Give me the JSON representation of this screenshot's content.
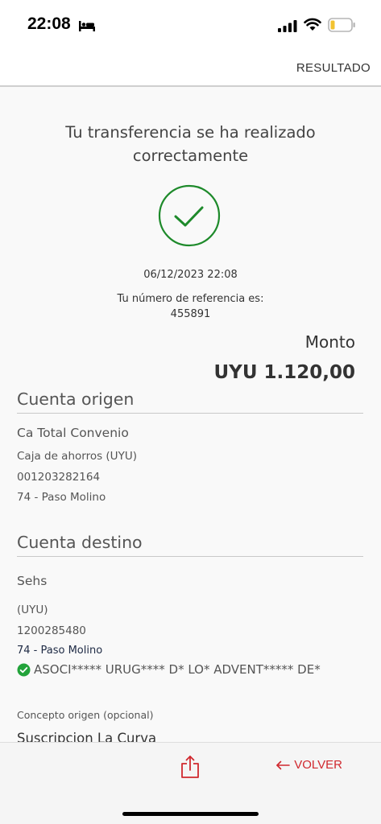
{
  "status_bar": {
    "time": "22:08"
  },
  "header": {
    "title": "RESULTADO"
  },
  "result": {
    "message": "Tu transferencia se ha realizado correctamente",
    "datetime": "06/12/2023 22:08",
    "reference_label": "Tu número de referencia es:",
    "reference_number": "455891",
    "amount_label": "Monto",
    "amount_value": "UYU 1.120,00"
  },
  "origin": {
    "section_title": "Cuenta origen",
    "account_name": "Ca Total Convenio",
    "account_type": "Caja de ahorros (UYU)",
    "account_number": "001203282164",
    "branch": "74 - Paso Molino"
  },
  "destination": {
    "section_title": "Cuenta destino",
    "account_name": "Sehs",
    "currency": "(UYU)",
    "account_number": "1200285480",
    "branch": "74 - Paso Molino",
    "beneficiary": "ASOCI***** URUG**** D* LO* ADVENT***** DE*"
  },
  "concept": {
    "label": "Concepto origen (opcional)",
    "value": "Suscripcion La Curva"
  },
  "footer": {
    "back_label": "VOLVER"
  },
  "colors": {
    "accent": "#d0282e",
    "success": "#1e8a2b",
    "verified": "#22a33a"
  },
  "icons": {
    "share": "share-icon",
    "back": "arrow-left-icon",
    "success": "check-circle-icon"
  }
}
